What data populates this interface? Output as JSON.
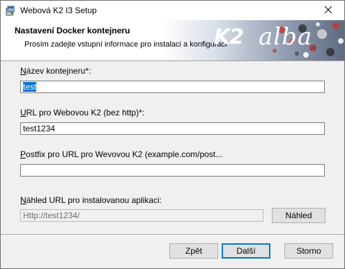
{
  "window": {
    "title": "Webová K2 I3 Setup",
    "app_icon": "installer-icon",
    "close_icon": "close-icon"
  },
  "banner": {
    "title": "Nastavení Docker kontejneru",
    "subtitle": "Prosím zadejte vstupní informace pro instalaci a konfiguraci",
    "logo_k2": "K2",
    "logo_alba": "alba"
  },
  "form": {
    "container_name": {
      "label_first": "N",
      "label_rest": "ázev kontejneru*:",
      "value": "test"
    },
    "url": {
      "label_first": "U",
      "label_rest": "RL pro Webovou K2 (bez http)*:",
      "value": "test1234"
    },
    "postfix": {
      "label_first": "P",
      "label_rest": "ostfix pro URL pro Wevovou K2 (example.com/post...",
      "value": ""
    },
    "preview": {
      "label_first": "N",
      "label_rest": "áhled URL pro instalovanou aplikaci:",
      "value": "Http://test1234/",
      "button": "Náhled"
    }
  },
  "buttons": {
    "back": "Zpět",
    "next": "Další",
    "cancel": "Storno"
  }
}
